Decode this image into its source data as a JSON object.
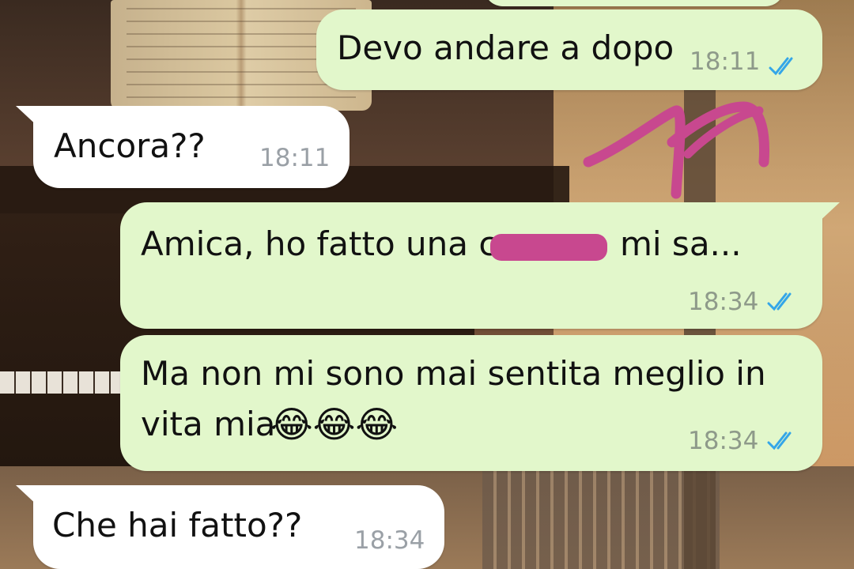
{
  "messages": [
    {
      "direction": "outgoing",
      "text": "Devo andare a dopo",
      "time": "18:11",
      "status": "read"
    },
    {
      "direction": "incoming",
      "text": "Ancora??",
      "time": "18:11"
    },
    {
      "direction": "outgoing",
      "text": "Amica, ho fatto una c",
      "text_after": "mi sa...",
      "time": "18:34",
      "status": "read",
      "redacted": true
    },
    {
      "direction": "outgoing",
      "line1": "Ma non mi sono mai sentita meglio in",
      "line2": "vita mia",
      "emojis": "😂😂😂",
      "time": "18:34",
      "status": "read"
    },
    {
      "direction": "incoming",
      "text": "Che hai fatto??",
      "time": "18:34"
    }
  ],
  "colors": {
    "outgoing_bubble": "#e2f7cb",
    "incoming_bubble": "#ffffff",
    "read_ticks": "#34a6e8",
    "redaction": "#c8488f",
    "scribble": "#c8488f"
  },
  "icons": {
    "read_receipt": "double-check-icon",
    "emoji": "face-with-tears-of-joy"
  }
}
